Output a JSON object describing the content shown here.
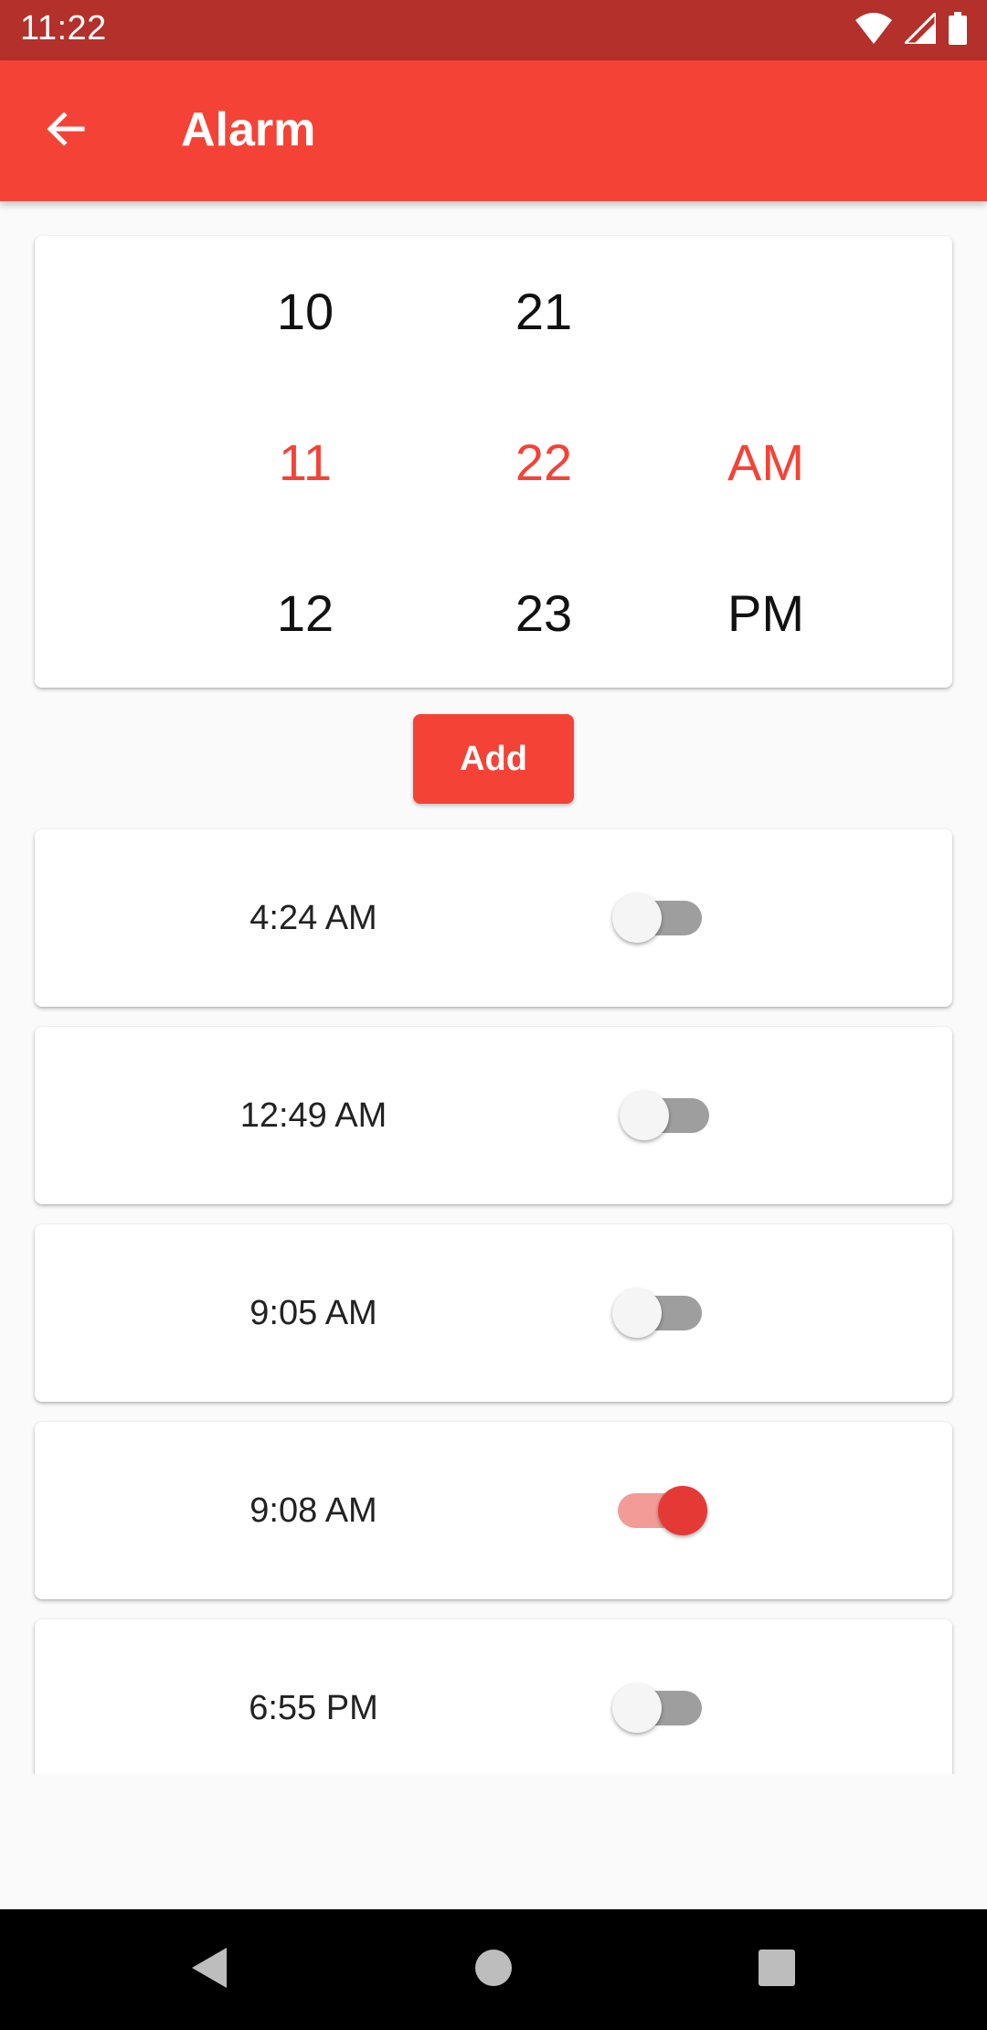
{
  "status_bar": {
    "time": "11:22",
    "icons": [
      "wifi-icon",
      "signal-icon",
      "battery-icon"
    ]
  },
  "app_bar": {
    "title": "Alarm",
    "back_icon": "arrow-back-icon",
    "color": "#f44336"
  },
  "picker": {
    "hours": [
      "10",
      "11",
      "12"
    ],
    "minutes": [
      "21",
      "22",
      "23"
    ],
    "periods": [
      "",
      "AM",
      "PM"
    ],
    "selected_hour": "11",
    "selected_minute": "22",
    "selected_period": "AM",
    "selected_color": "#f44336"
  },
  "add_button": {
    "label": "Add"
  },
  "alarms": [
    {
      "time": "4:24 AM",
      "enabled": false
    },
    {
      "time": "12:49 AM",
      "enabled": false
    },
    {
      "time": "9:05 AM",
      "enabled": false
    },
    {
      "time": "9:08 AM",
      "enabled": true
    },
    {
      "time": "6:55 PM",
      "enabled": false
    }
  ],
  "nav_bar": {
    "buttons": [
      "back-triangle-icon",
      "home-circle-icon",
      "recents-square-icon"
    ]
  }
}
